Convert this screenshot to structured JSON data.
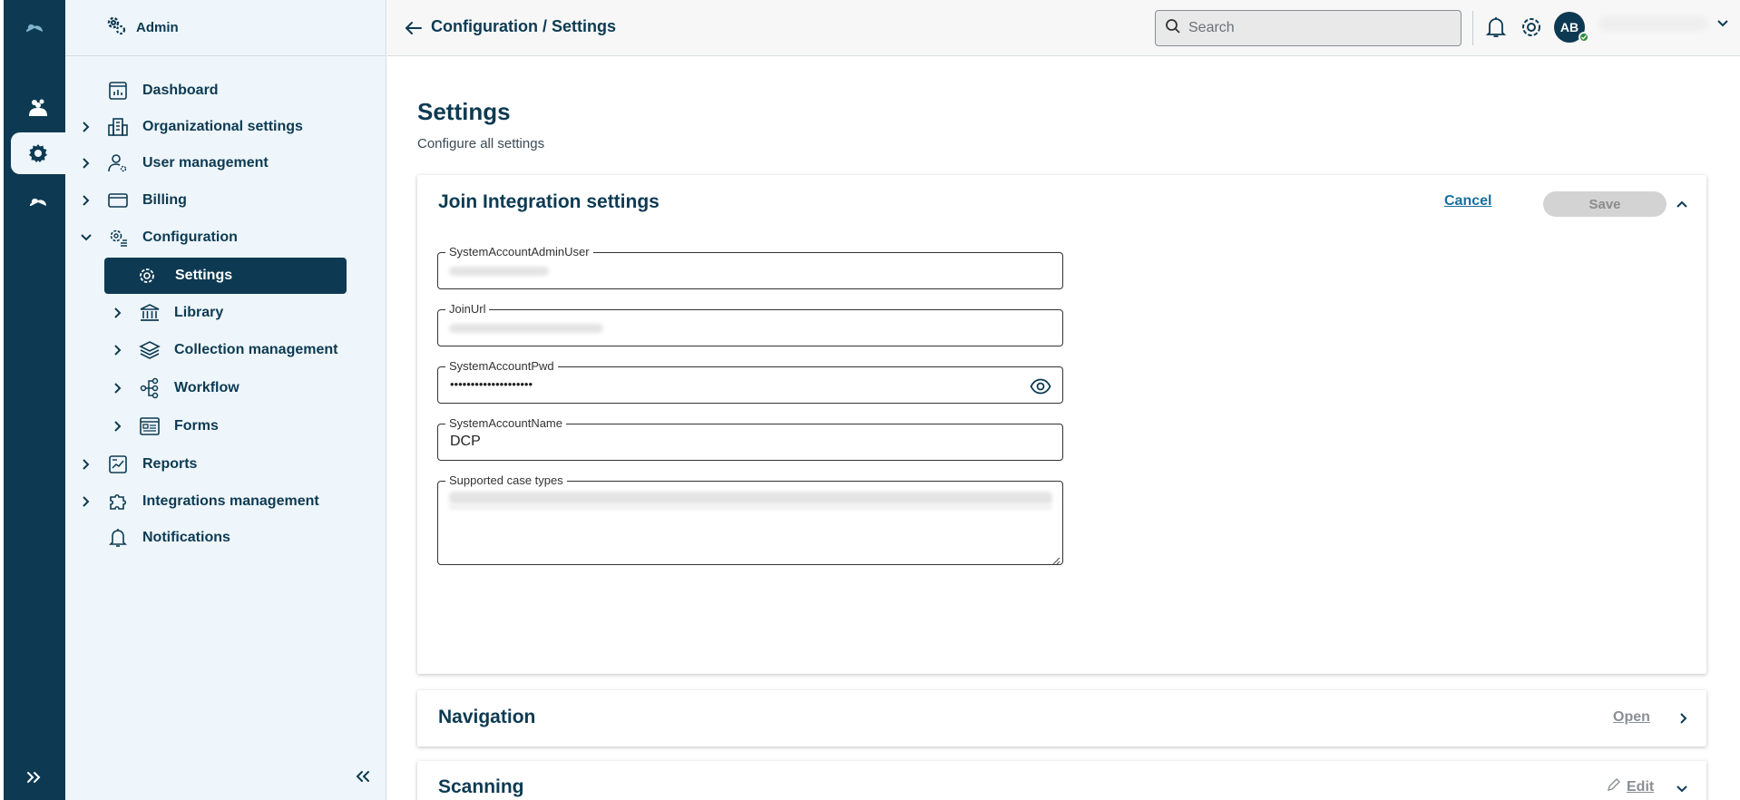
{
  "sidebar": {
    "title": "Admin",
    "items": [
      {
        "label": "Dashboard"
      },
      {
        "label": "Organizational settings"
      },
      {
        "label": "User management"
      },
      {
        "label": "Billing"
      },
      {
        "label": "Configuration"
      },
      {
        "label": "Settings"
      },
      {
        "label": "Library"
      },
      {
        "label": "Collection management"
      },
      {
        "label": "Workflow"
      },
      {
        "label": "Forms"
      },
      {
        "label": "Reports"
      },
      {
        "label": "Integrations management"
      },
      {
        "label": "Notifications"
      }
    ]
  },
  "topbar": {
    "breadcrumb": "Configuration / Settings",
    "search_placeholder": "Search",
    "avatar_initials": "AB"
  },
  "page": {
    "title": "Settings",
    "subtitle": "Configure all settings"
  },
  "join_panel": {
    "title": "Join Integration settings",
    "cancel_label": "Cancel",
    "save_label": "Save",
    "fields": [
      {
        "label": "SystemAccountAdminUser",
        "value": ""
      },
      {
        "label": "JoinUrl",
        "value": ""
      },
      {
        "label": "SystemAccountPwd",
        "value": "••••••••••••••••••••"
      },
      {
        "label": "SystemAccountName",
        "value": "DCP"
      },
      {
        "label": "Supported case types",
        "value": ""
      }
    ]
  },
  "navigation_panel": {
    "title": "Navigation",
    "open_label": "Open"
  },
  "scanning_panel": {
    "title": "Scanning",
    "edit_label": "Edit"
  },
  "colors": {
    "brand": "#0d3a52",
    "sidebar_bg": "#eef6fb",
    "link": "#1a6e9c",
    "status_online": "#2e8b3e"
  },
  "icons": {
    "rail": [
      "cloud-logo-icon",
      "people-icon",
      "gear-icon",
      "cloud-icon",
      "expand-icon"
    ],
    "nav": [
      "dashboard-icon",
      "building-icon",
      "user-gear-icon",
      "card-icon",
      "config-gear-icon",
      "gear-icon",
      "library-icon",
      "layers-icon",
      "workflow-icon",
      "form-icon",
      "report-icon",
      "puzzle-icon",
      "bell-icon"
    ]
  }
}
